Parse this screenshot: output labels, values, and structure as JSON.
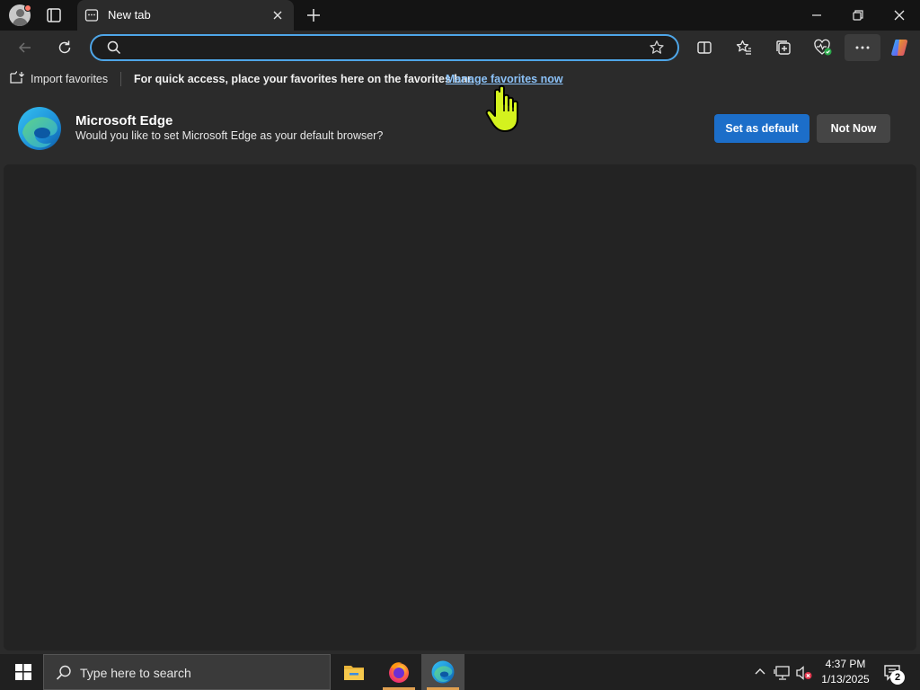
{
  "tabstrip": {
    "profile_icon": "user-avatar-icon",
    "tab_actions_icon": "tab-actions-icon",
    "active_tab": {
      "title": "New tab",
      "favicon": "new-tab-page-icon",
      "close_icon": "close-icon"
    },
    "new_tab_icon": "plus-icon",
    "window_controls": [
      "minimize-icon",
      "restore-icon",
      "close-icon"
    ]
  },
  "toolbar": {
    "back_icon": "arrow-left-icon",
    "refresh_icon": "refresh-icon",
    "address": {
      "value": "",
      "placeholder": ""
    },
    "icons": [
      "search-icon",
      "star-icon",
      "split-screen-icon",
      "favorites-icon",
      "collections-icon",
      "browser-essentials-icon",
      "more-icon",
      "copilot-icon"
    ]
  },
  "favorites_bar": {
    "import_label": "Import favorites",
    "message": "For quick access, place your favorites here on the favorites bar.",
    "link": "Manage favorites now"
  },
  "banner": {
    "title": "Microsoft Edge",
    "subtitle": "Would you like to set Microsoft Edge as your default browser?",
    "primary_button": "Set as default",
    "secondary_button": "Not Now"
  },
  "taskbar": {
    "search_placeholder": "Type here to search",
    "apps": [
      "file-explorer-icon",
      "firefox-icon",
      "edge-icon"
    ],
    "clock": {
      "time": "4:37 PM",
      "date": "1/13/2025"
    },
    "notification_count": "2"
  },
  "colors": {
    "accent": "#1c6ec9",
    "link": "#8bc1f7",
    "address_border": "#4ea6e8",
    "cursor": "#d4f21e"
  }
}
